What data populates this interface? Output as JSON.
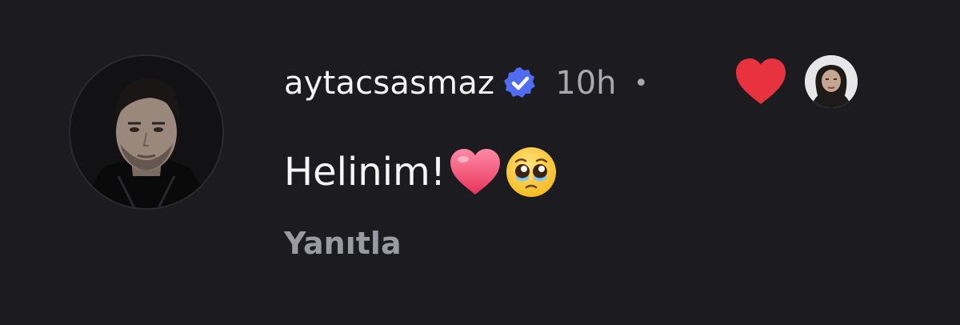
{
  "comment": {
    "username": "aytacsasmaz",
    "verified_icon": "verified-badge-icon",
    "time": "10h",
    "separator": "•",
    "text": "Helinim!",
    "emojis": [
      "❤️",
      "🥹"
    ],
    "reply_label": "Yanıtla",
    "reaction_icon": "heart-icon",
    "colors": {
      "background": "#1c1c20",
      "verified": "#4f6cf3",
      "heart": "#e8323f",
      "secondary_text": "#a8a8b0"
    }
  }
}
